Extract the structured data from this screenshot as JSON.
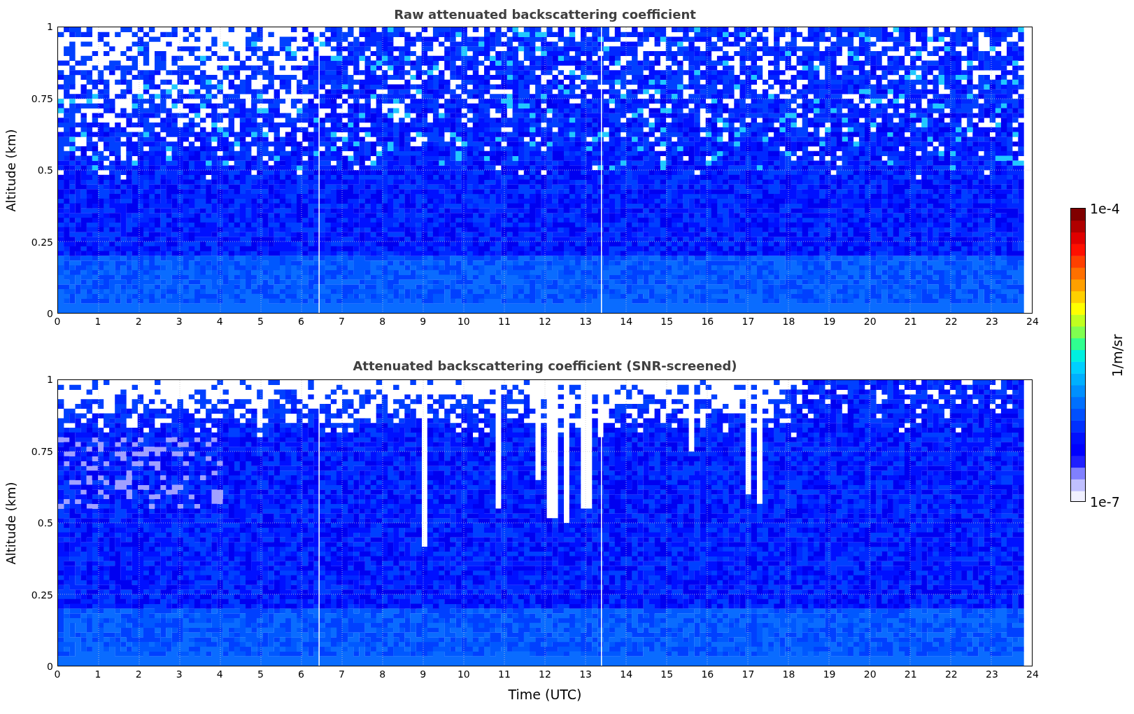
{
  "panels": [
    {
      "kind": "raw",
      "title": "Raw attenuated backscattering coefficient",
      "ylabel": "Altitude (km)",
      "yticks": [
        "1",
        "0.75",
        "0.5",
        "0.25",
        "0"
      ],
      "xticks": [
        "0",
        "1",
        "2",
        "3",
        "4",
        "5",
        "6",
        "7",
        "8",
        "9",
        "10",
        "11",
        "12",
        "13",
        "14",
        "15",
        "16",
        "17",
        "18",
        "19",
        "20",
        "21",
        "22",
        "23",
        "24"
      ]
    },
    {
      "kind": "screened",
      "title": "Attenuated backscattering coefficient (SNR-screened)",
      "ylabel": "Altitude (km)",
      "yticks": [
        "1",
        "0.75",
        "0.5",
        "0.25",
        "0"
      ],
      "xticks": [
        "0",
        "1",
        "2",
        "3",
        "4",
        "5",
        "6",
        "7",
        "8",
        "9",
        "10",
        "11",
        "12",
        "13",
        "14",
        "15",
        "16",
        "17",
        "18",
        "19",
        "20",
        "21",
        "22",
        "23",
        "24"
      ]
    }
  ],
  "xlabel": "Time (UTC)",
  "colorbar": {
    "max_label": "1e-4",
    "min_label": "1e-7",
    "unit": "1/m/sr"
  }
}
